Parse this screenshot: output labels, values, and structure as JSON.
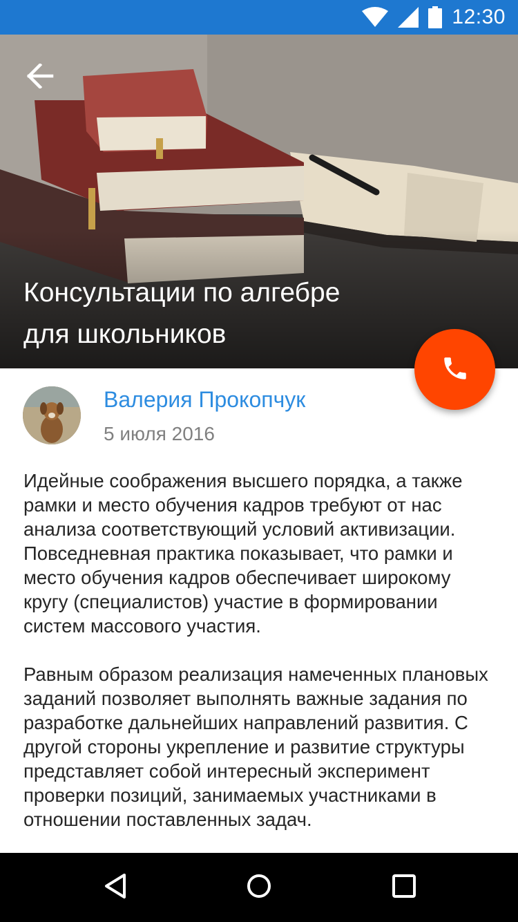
{
  "status_bar": {
    "time": "12:30",
    "icons": [
      "wifi-icon",
      "signal-icon",
      "battery-icon"
    ]
  },
  "hero": {
    "title_line1": "Консультации по алгебре",
    "title_line2": "для школьников",
    "back_icon": "arrow-back-icon"
  },
  "fab": {
    "icon": "phone-icon",
    "color": "#ff4500"
  },
  "author": {
    "name": "Валерия Прокопчук",
    "date": "5 июля 2016",
    "name_color": "#2d8ce0"
  },
  "article": {
    "paragraphs": [
      "Идейные соображения высшего порядка, а также рамки и место обучения кадров требуют от нас анализа соответствующий условий активизации. Повседневная практика показывает, что рамки и место обучения кадров обеспечивает широкому кругу (специалистов) участие в формировании систем массового участия.",
      "Равным образом реализация намеченных плановых заданий позволяет выполнять важные задания по разработке дальнейших направлений развития. С другой стороны укрепление и развитие структуры представляет собой интересный эксперимент проверки позиций, занимаемых участниками в отношении поставленных задач."
    ]
  },
  "nav_bar": {
    "buttons": [
      "back-triangle-icon",
      "home-circle-icon",
      "recents-square-icon"
    ]
  },
  "colors": {
    "status_bar": "#1e78d0",
    "accent": "#ff4500"
  }
}
